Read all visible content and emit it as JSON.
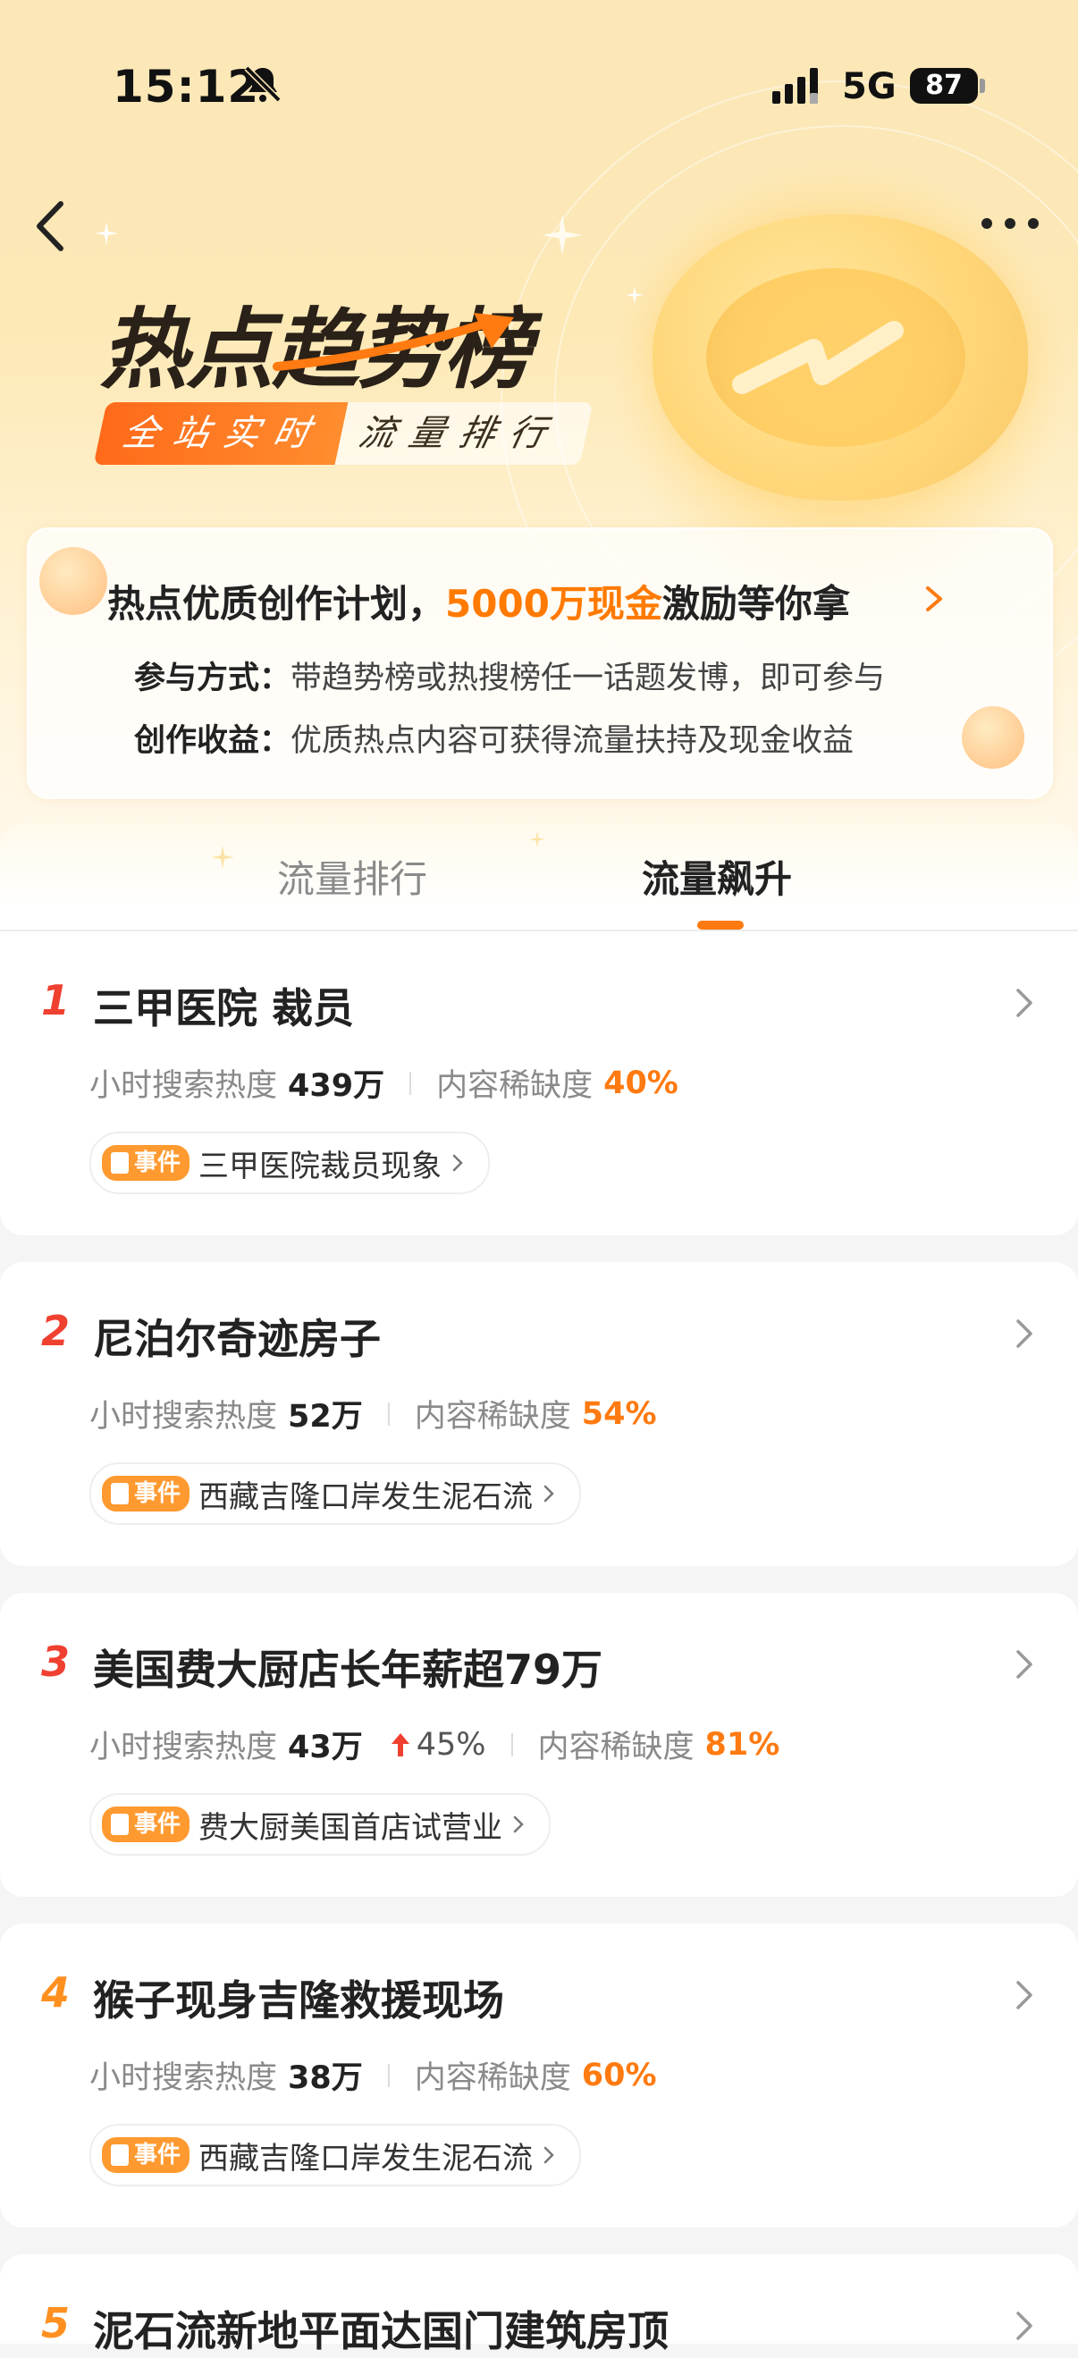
{
  "status_bar": {
    "time": "15:12",
    "network": "5G",
    "battery": "87"
  },
  "banner": {
    "title": "热点趋势榜",
    "tag_primary": "全站实时",
    "tag_secondary": "流量排行"
  },
  "plan": {
    "title_prefix": "热点优质创作计划，",
    "title_highlight": "5000万现金",
    "title_suffix": "激励等你拿",
    "line1_label": "参与方式：",
    "line1_text": "带趋势榜或热搜榜任一话题发博，即可参与",
    "line2_label": "创作收益：",
    "line2_text": "优质热点内容可获得流量扶持及现金收益"
  },
  "tabs": [
    {
      "label": "流量排行",
      "active": false
    },
    {
      "label": "流量飙升",
      "active": true
    }
  ],
  "labels": {
    "search_heat": "小时搜索热度",
    "scarcity": "内容稀缺度",
    "event_tag": "事件"
  },
  "items": [
    {
      "rank": "1",
      "title": "三甲医院 裁员",
      "heat": "439万",
      "change": "",
      "scarcity": "40%",
      "event": "三甲医院裁员现象"
    },
    {
      "rank": "2",
      "title": "尼泊尔奇迹房子",
      "heat": "52万",
      "change": "",
      "scarcity": "54%",
      "event": "西藏吉隆口岸发生泥石流"
    },
    {
      "rank": "3",
      "title": "美国费大厨店长年薪超79万",
      "heat": "43万",
      "change": "45%",
      "scarcity": "81%",
      "event": "费大厨美国首店试营业"
    },
    {
      "rank": "4",
      "title": "猴子现身吉隆救援现场",
      "heat": "38万",
      "change": "",
      "scarcity": "60%",
      "event": "西藏吉隆口岸发生泥石流"
    },
    {
      "rank": "5",
      "title": "泥石流新地平面达国门建筑房顶"
    }
  ],
  "colors": {
    "accent": "#ff7a10",
    "rank_top": "#f04030",
    "rank_other": "#ff9020"
  }
}
